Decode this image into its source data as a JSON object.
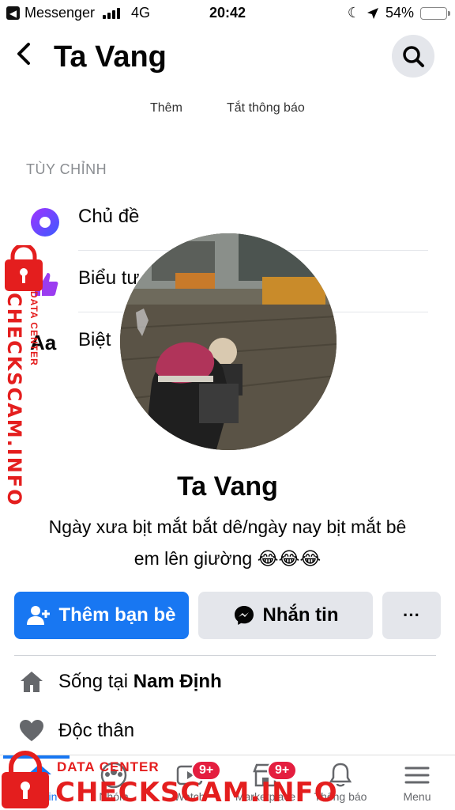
{
  "status_bar": {
    "back_app": "Messenger",
    "network": "4G",
    "time": "20:42",
    "battery": "54%",
    "battery_level": 0.54
  },
  "header": {
    "title": "Ta Vang"
  },
  "faded_actions": [
    "Thêm",
    "Tắt thông báo"
  ],
  "customize": {
    "section_label": "TÙY CHỈNH",
    "items": [
      {
        "label": "Chủ đề"
      },
      {
        "label": "Biểu tư"
      },
      {
        "label": "Biệt"
      }
    ]
  },
  "profile": {
    "name": "Ta Vang",
    "bio_line1": "Ngày xưa bịt mắt bắt dê/ngày nay bịt mắt bê",
    "bio_line2": "em lên giường 😂😂😂"
  },
  "actions": {
    "add_friend": "Thêm bạn bè",
    "message": "Nhắn tin",
    "more": "···"
  },
  "info": {
    "lives_prefix": "Sống tại ",
    "lives_place": "Nam Định",
    "relationship": "Độc thân"
  },
  "bottom_nav": [
    {
      "label": "tin",
      "active": true
    },
    {
      "label": "Nhóm"
    },
    {
      "label": "Watch",
      "badge": "9+"
    },
    {
      "label": "Marketplace",
      "badge": "9+"
    },
    {
      "label": "Thông báo"
    },
    {
      "label": "Menu"
    }
  ],
  "watermark": {
    "big": "CHECKSCAM.INFO",
    "small": "DATA CENTER"
  },
  "colors": {
    "accent": "#1877f2",
    "watermark": "#e41e1e",
    "badge": "#e41e3f"
  }
}
